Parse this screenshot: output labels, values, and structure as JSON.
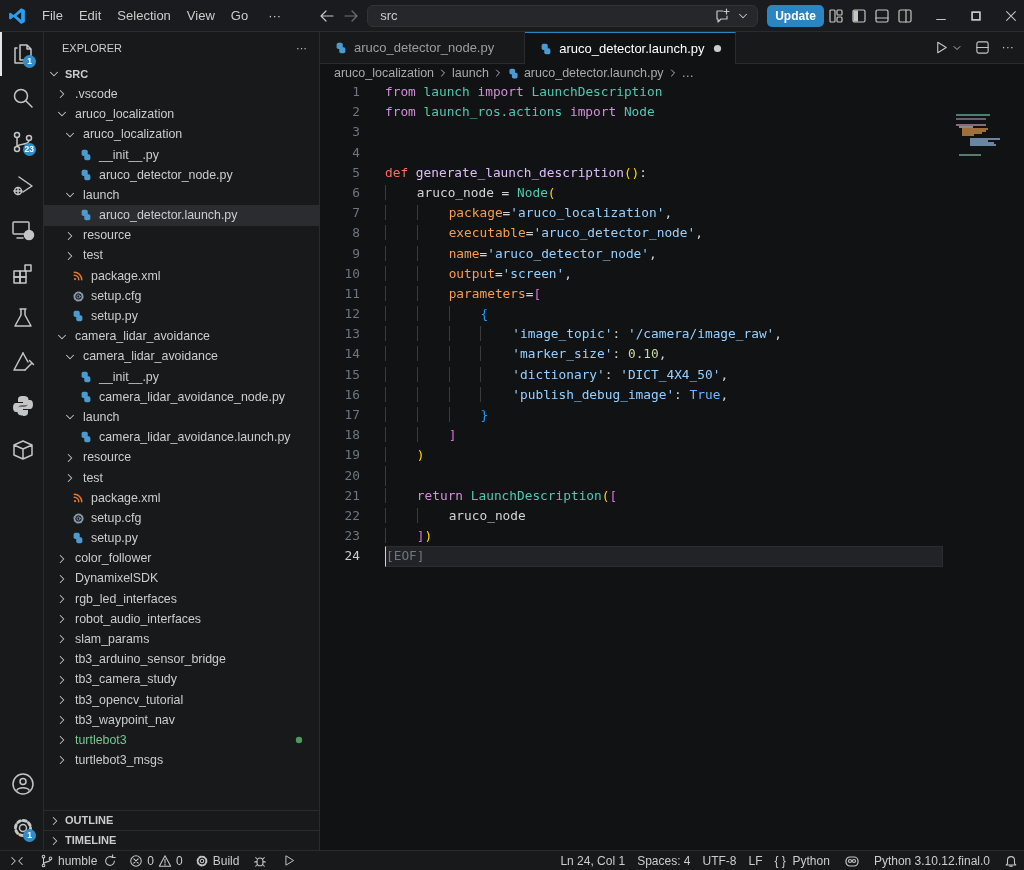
{
  "title_bar": {
    "menus": [
      "File",
      "Edit",
      "Selection",
      "View",
      "Go"
    ],
    "more": "···",
    "search": {
      "value": "src"
    },
    "update_button": "Update"
  },
  "activity_bar": {
    "items": [
      {
        "kind": "explorer",
        "selected": true,
        "badge": "1"
      },
      {
        "kind": "search",
        "selected": false
      },
      {
        "kind": "source-control",
        "selected": false,
        "badge": "23"
      },
      {
        "kind": "run-debug",
        "selected": false
      },
      {
        "kind": "remote",
        "selected": false
      },
      {
        "kind": "extensions",
        "selected": false
      },
      {
        "kind": "testing",
        "selected": false
      },
      {
        "kind": "tool",
        "selected": false
      },
      {
        "kind": "python",
        "selected": false
      },
      {
        "kind": "container",
        "selected": false
      }
    ],
    "bottom": [
      {
        "kind": "account"
      },
      {
        "kind": "settings",
        "badge": "1"
      }
    ]
  },
  "sidebar": {
    "title": "EXPLORER",
    "more": "···",
    "root": {
      "label": "SRC",
      "expanded": true
    },
    "tree": [
      {
        "label": ".vscode",
        "kind": "folder",
        "expanded": false,
        "selected": false,
        "modified": false
      },
      {
        "label": "aruco_localization",
        "kind": "folder",
        "expanded": true,
        "selected": false,
        "modified": false,
        "children": [
          {
            "label": "aruco_localization",
            "kind": "folder",
            "expanded": true,
            "selected": false,
            "children": [
              {
                "label": "__init__.py",
                "kind": "python",
                "selected": false
              },
              {
                "label": "aruco_detector_node.py",
                "kind": "python",
                "selected": false
              }
            ]
          },
          {
            "label": "launch",
            "kind": "folder",
            "expanded": true,
            "selected": false,
            "children": [
              {
                "label": "aruco_detector.launch.py",
                "kind": "python",
                "selected": true
              }
            ]
          },
          {
            "label": "resource",
            "kind": "folder",
            "expanded": false,
            "selected": false
          },
          {
            "label": "test",
            "kind": "folder",
            "expanded": false,
            "selected": false
          },
          {
            "label": "package.xml",
            "kind": "xml",
            "selected": false
          },
          {
            "label": "setup.cfg",
            "kind": "config",
            "selected": false
          },
          {
            "label": "setup.py",
            "kind": "python",
            "selected": false
          }
        ]
      },
      {
        "label": "camera_lidar_avoidance",
        "kind": "folder",
        "expanded": true,
        "selected": false,
        "modified": false,
        "children": [
          {
            "label": "camera_lidar_avoidance",
            "kind": "folder",
            "expanded": true,
            "selected": false,
            "children": [
              {
                "label": "__init__.py",
                "kind": "python",
                "selected": false
              },
              {
                "label": "camera_lidar_avoidance_node.py",
                "kind": "python",
                "selected": false
              }
            ]
          },
          {
            "label": "launch",
            "kind": "folder",
            "expanded": true,
            "selected": false,
            "children": [
              {
                "label": "camera_lidar_avoidance.launch.py",
                "kind": "python",
                "selected": false
              }
            ]
          },
          {
            "label": "resource",
            "kind": "folder",
            "expanded": false,
            "selected": false
          },
          {
            "label": "test",
            "kind": "folder",
            "expanded": false,
            "selected": false
          },
          {
            "label": "package.xml",
            "kind": "xml",
            "selected": false
          },
          {
            "label": "setup.cfg",
            "kind": "config",
            "selected": false
          },
          {
            "label": "setup.py",
            "kind": "python",
            "selected": false
          }
        ]
      },
      {
        "label": "color_follower",
        "kind": "folder",
        "expanded": false,
        "selected": false,
        "modified": false
      },
      {
        "label": "DynamixelSDK",
        "kind": "folder",
        "expanded": false,
        "selected": false,
        "modified": false
      },
      {
        "label": "rgb_led_interfaces",
        "kind": "folder",
        "expanded": false,
        "selected": false,
        "modified": false
      },
      {
        "label": "robot_audio_interfaces",
        "kind": "folder",
        "expanded": false,
        "selected": false,
        "modified": false
      },
      {
        "label": "slam_params",
        "kind": "folder",
        "expanded": false,
        "selected": false,
        "modified": false
      },
      {
        "label": "tb3_arduino_sensor_bridge",
        "kind": "folder",
        "expanded": false,
        "selected": false,
        "modified": false
      },
      {
        "label": "tb3_camera_study",
        "kind": "folder",
        "expanded": false,
        "selected": false,
        "modified": false
      },
      {
        "label": "tb3_opencv_tutorial",
        "kind": "folder",
        "expanded": false,
        "selected": false,
        "modified": false
      },
      {
        "label": "tb3_waypoint_nav",
        "kind": "folder",
        "expanded": false,
        "selected": false,
        "modified": false
      },
      {
        "label": "turtlebot3",
        "kind": "folder",
        "expanded": false,
        "selected": false,
        "modified": true
      },
      {
        "label": "turtlebot3_msgs",
        "kind": "folder",
        "expanded": false,
        "selected": false,
        "modified": false
      }
    ],
    "sections": [
      {
        "label": "OUTLINE",
        "expanded": false
      },
      {
        "label": "TIMELINE",
        "expanded": false
      }
    ]
  },
  "editor": {
    "tabs": [
      {
        "label": "aruco_detector_node.py",
        "selected": false,
        "modified": false
      },
      {
        "label": "aruco_detector.launch.py",
        "selected": true,
        "modified": true
      }
    ],
    "more": "···",
    "breadcrumb": [
      {
        "text": "aruco_localization",
        "kind": "folder"
      },
      {
        "text": "launch",
        "kind": "folder"
      },
      {
        "text": "aruco_detector.launch.py",
        "kind": "python"
      },
      {
        "text": "…",
        "kind": "more"
      }
    ],
    "lines": [
      {
        "number": "1",
        "current": false,
        "text": "from launch import LaunchDescription"
      },
      {
        "number": "2",
        "current": false,
        "text": "from launch_ros.actions import Node"
      },
      {
        "number": "3",
        "current": false
      },
      {
        "number": "4",
        "current": false
      },
      {
        "number": "5",
        "current": false,
        "text": "def generate_launch_description():"
      },
      {
        "number": "6",
        "current": false,
        "text": "    aruco_node = Node("
      },
      {
        "number": "7",
        "current": false,
        "text": "        package='aruco_localization',"
      },
      {
        "number": "8",
        "current": false,
        "text": "        executable='aruco_detector_node',"
      },
      {
        "number": "9",
        "current": false,
        "text": "        name='aruco_detector_node',"
      },
      {
        "number": "10",
        "current": false,
        "text": "        output='screen',"
      },
      {
        "number": "11",
        "current": false,
        "text": "        parameters=["
      },
      {
        "number": "12",
        "current": false,
        "text": "            {"
      },
      {
        "number": "13",
        "current": false,
        "text": "                'image_topic': '/camera/image_raw',"
      },
      {
        "number": "14",
        "current": false,
        "text": "                'marker_size': 0.10,"
      },
      {
        "number": "15",
        "current": false,
        "text": "                'dictionary': 'DICT_4X4_50',"
      },
      {
        "number": "16",
        "current": false,
        "text": "                'publish_debug_image': True,"
      },
      {
        "number": "17",
        "current": false,
        "text": "            }"
      },
      {
        "number": "18",
        "current": false,
        "text": "        ]"
      },
      {
        "number": "19",
        "current": false,
        "text": "    )"
      },
      {
        "number": "20",
        "current": false
      },
      {
        "number": "21",
        "current": false,
        "text": "    return LaunchDescription(["
      },
      {
        "number": "22",
        "current": false,
        "text": "        aruco_node"
      },
      {
        "number": "23",
        "current": false,
        "text": "    ])"
      },
      {
        "number": "24",
        "current": true,
        "text": "[EOF]",
        "kind": "eof"
      }
    ]
  },
  "status_bar": {
    "left": [
      {
        "kind": "remote"
      },
      {
        "kind": "branch",
        "text": "humble"
      },
      {
        "kind": "sync"
      },
      {
        "kind": "problems",
        "errors": "0",
        "warnings": "0"
      },
      {
        "kind": "build",
        "text": "Build"
      },
      {
        "kind": "debug"
      },
      {
        "kind": "run"
      }
    ],
    "right": [
      {
        "kind": "text",
        "text": "Ln 24, Col 1"
      },
      {
        "kind": "text",
        "text": "Spaces: 4"
      },
      {
        "kind": "text",
        "text": "UTF-8"
      },
      {
        "kind": "text",
        "text": "LF"
      },
      {
        "kind": "language",
        "icon_text": "{ }",
        "text": "Python"
      },
      {
        "kind": "copilot"
      },
      {
        "kind": "text",
        "text": "Python 3.10.12.final.0"
      },
      {
        "kind": "bell"
      }
    ]
  }
}
